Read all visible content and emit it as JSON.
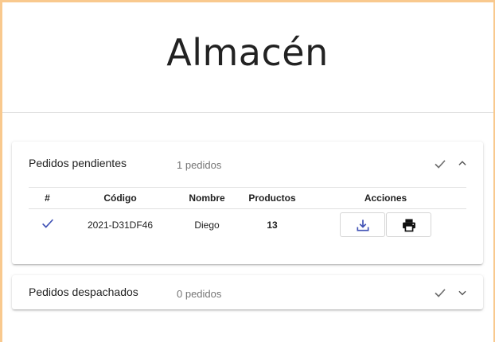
{
  "header": {
    "title": "Almacén"
  },
  "pending": {
    "title": "Pedidos pendientes",
    "count": "1 pedidos",
    "columns": [
      "#",
      "Código",
      "Nombre",
      "Productos",
      "Acciones"
    ],
    "rows": [
      {
        "status": "check-icon",
        "code": "2021-D31DF46",
        "name": "Diego",
        "products": "13"
      }
    ]
  },
  "dispatched": {
    "title": "Pedidos despachados",
    "count": "0 pedidos"
  },
  "icons": {
    "checkmark": "check-icon",
    "expand": "chevron-up-icon",
    "collapse": "chevron-down-icon",
    "download": "download-icon",
    "print": "printer-icon"
  },
  "colors": {
    "accent": "#3f51b5",
    "frame": "#f9c98e",
    "muted": "#757575"
  }
}
